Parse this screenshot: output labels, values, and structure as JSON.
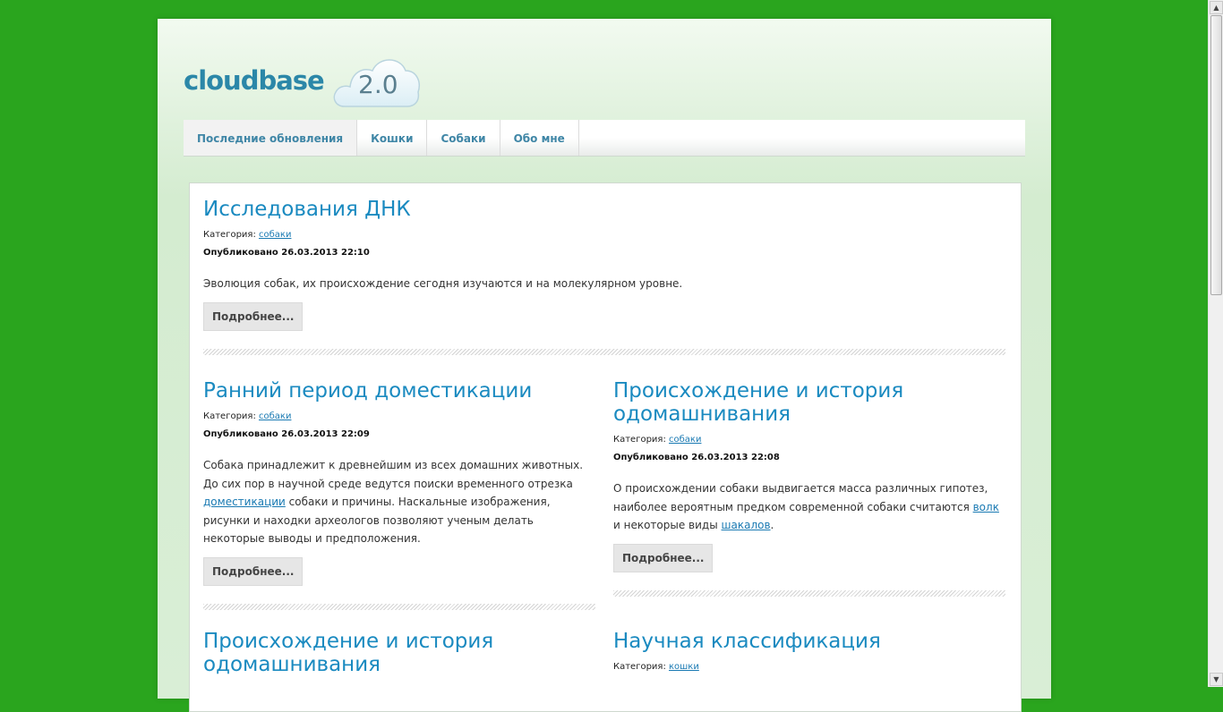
{
  "header": {
    "logo_text": "cloudbase",
    "version": "2.0"
  },
  "nav": {
    "items": [
      {
        "label": "Последние обновления"
      },
      {
        "label": "Кошки"
      },
      {
        "label": "Собаки"
      },
      {
        "label": "Обо мне"
      }
    ]
  },
  "articles": [
    {
      "title": "Исследования ДНК",
      "category_label": "Категория:",
      "category": "собаки",
      "published": "Опубликовано 26.03.2013 22:10",
      "text": "Эволюция собак, их происхождение сегодня изучаются и на молекулярном уровне.",
      "more": "Подробнее..."
    },
    {
      "title": "Ранний период доместикации",
      "category_label": "Категория:",
      "category": "собаки",
      "published": "Опубликовано 26.03.2013 22:09",
      "text_before": "Собака принадлежит к древнейшим из всех домашних животных. До сих пор в научной среде ведутся поиски временного отрезка ",
      "link1": "доместикации",
      "text_after": " собаки и причины. Наскальные изображения, рисунки и находки археологов позволяют ученым делать некоторые выводы и предположения.",
      "more": "Подробнее..."
    },
    {
      "title": "Происхождение и история одомашнивания",
      "category_label": "Категория:",
      "category": "собаки",
      "published": "Опубликовано 26.03.2013 22:08",
      "text_before": "О происхождении собаки выдвигается масса различных гипотез, наиболее вероятным предком современной собаки считаются ",
      "link1": "волк",
      "text_mid": " и некоторые виды ",
      "link2": "шакалов",
      "text_after": ".",
      "more": "Подробнее..."
    },
    {
      "title": "Происхождение и история одомашнивания"
    },
    {
      "title": "Научная классификация",
      "category_label": "Категория:",
      "category": "кошки"
    }
  ],
  "scrollbar": {
    "up_icon": "arrow-up-icon",
    "down_icon": "arrow-down-icon"
  }
}
